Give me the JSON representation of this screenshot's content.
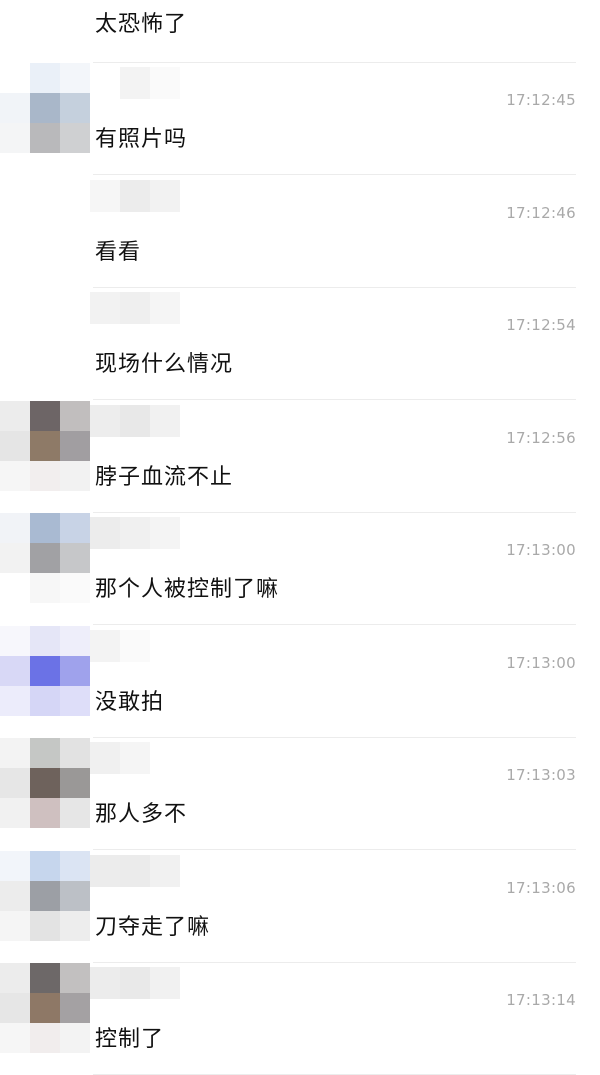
{
  "first_message": "太恐怖了",
  "messages": [
    {
      "time": "17:12:45",
      "text": "有照片吗",
      "avatar": [
        "#ffffff",
        "#eaf0f8",
        "#f3f6fa",
        "#f1f4f8",
        "#a9b7c9",
        "#c5d0dd",
        "#f4f5f6",
        "#b9b9bb",
        "#cfd0d2"
      ],
      "name": [
        "#ffffff",
        "#f3f3f3",
        "#fafafa"
      ]
    },
    {
      "time": "17:12:46",
      "text": "看看",
      "avatar": [
        "#ffffff",
        "#ffffff",
        "#ffffff",
        "#ffffff",
        "#ffffff",
        "#ffffff",
        "#ffffff",
        "#ffffff",
        "#ffffff"
      ],
      "name": [
        "#f6f6f6",
        "#ececec",
        "#f2f2f2"
      ]
    },
    {
      "time": "17:12:54",
      "text": "现场什么情况",
      "avatar": [
        "#ffffff",
        "#ffffff",
        "#ffffff",
        "#ffffff",
        "#ffffff",
        "#ffffff",
        "#ffffff",
        "#ffffff",
        "#ffffff"
      ],
      "name": [
        "#f2f2f2",
        "#efefef",
        "#f5f5f5"
      ]
    },
    {
      "time": "17:12:56",
      "text": "脖子血流不止",
      "avatar": [
        "#ececec",
        "#6d6566",
        "#c1bebe",
        "#e5e5e5",
        "#8e7a67",
        "#a19ea1",
        "#f6f6f6",
        "#f2eeee",
        "#f2f2f2"
      ],
      "name": [
        "#ededed",
        "#e8e8e8",
        "#f1f1f1"
      ]
    },
    {
      "time": "17:13:00",
      "text": "那个人被控制了嘛",
      "avatar": [
        "#f1f3f7",
        "#a9bad2",
        "#c8d3e6",
        "#f2f2f2",
        "#a1a1a4",
        "#c6c7c9",
        "#ffffff",
        "#f7f7f7",
        "#fafafa"
      ],
      "name": [
        "#ececec",
        "#f0f0f0",
        "#f4f4f4"
      ]
    },
    {
      "time": "17:13:00",
      "text": "没敢拍",
      "avatar": [
        "#f7f7fc",
        "#e5e6f7",
        "#eeeefa",
        "#d8d8f6",
        "#6b72e6",
        "#9fa2ec",
        "#ececfb",
        "#d5d6f6",
        "#dedef9"
      ],
      "name": [
        "#f3f3f3",
        "#fafafa",
        "#ffffff"
      ]
    },
    {
      "time": "17:13:03",
      "text": "那人多不",
      "avatar": [
        "#f3f3f3",
        "#c5c7c5",
        "#e2e2e2",
        "#e6e6e6",
        "#6e625c",
        "#9a9897",
        "#f1f1f1",
        "#cfc0c0",
        "#e6e6e6"
      ],
      "name": [
        "#f0f0f0",
        "#f5f5f5",
        "#ffffff"
      ]
    },
    {
      "time": "17:13:06",
      "text": "刀夺走了嘛",
      "avatar": [
        "#f2f5fa",
        "#c6d6ed",
        "#dbe4f3",
        "#ececec",
        "#9c9fa5",
        "#bcc0c6",
        "#f5f5f5",
        "#e3e3e3",
        "#ededed"
      ],
      "name": [
        "#ececec",
        "#ebebeb",
        "#f1f1f1"
      ]
    },
    {
      "time": "17:13:14",
      "text": "控制了",
      "avatar": [
        "#ececec",
        "#6d6868",
        "#c2c0c0",
        "#e6e6e6",
        "#8e7866",
        "#a4a1a3",
        "#f6f6f6",
        "#f1eded",
        "#f3f3f3"
      ],
      "name": [
        "#ececec",
        "#e9e9e9",
        "#f1f1f1"
      ]
    }
  ]
}
